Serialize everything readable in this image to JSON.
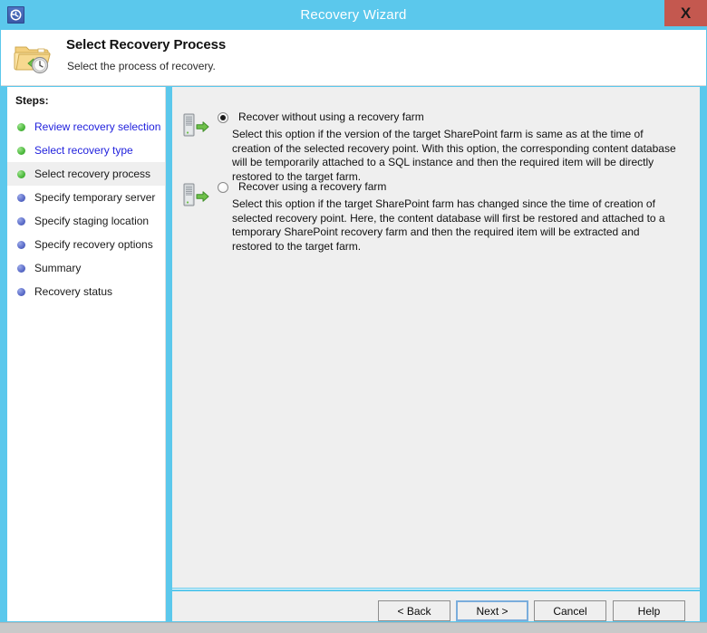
{
  "window": {
    "title": "Recovery Wizard",
    "app_icon": "recovery-clock-icon",
    "close_label": "X",
    "accent_color": "#5bc8ec",
    "close_button_color": "#c4584f"
  },
  "header": {
    "icon": "folder-clock-icon",
    "title": "Select Recovery Process",
    "subtitle": "Select the process of recovery."
  },
  "sidebar": {
    "heading": "Steps:",
    "items": [
      {
        "label": "Review recovery selection",
        "state": "done",
        "is_link": true,
        "current": false
      },
      {
        "label": "Select recovery type",
        "state": "done",
        "is_link": true,
        "current": false
      },
      {
        "label": "Select recovery process",
        "state": "done",
        "is_link": false,
        "current": true
      },
      {
        "label": "Specify temporary server",
        "state": "pending",
        "is_link": false,
        "current": false
      },
      {
        "label": "Specify staging location",
        "state": "pending",
        "is_link": false,
        "current": false
      },
      {
        "label": "Specify recovery options",
        "state": "pending",
        "is_link": false,
        "current": false
      },
      {
        "label": "Summary",
        "state": "pending",
        "is_link": false,
        "current": false
      },
      {
        "label": "Recovery status",
        "state": "pending",
        "is_link": false,
        "current": false
      }
    ]
  },
  "main": {
    "options": [
      {
        "icon": "server-restore-icon",
        "title": "Recover without using a recovery farm",
        "selected": true,
        "description": "Select this option if the version of the target SharePoint farm is same as at the time of creation of the selected recovery point. With this option, the corresponding content database will be temporarily attached to a SQL instance and then the required item will be directly restored to the target farm."
      },
      {
        "icon": "server-restore-icon",
        "title": "Recover using a recovery farm",
        "selected": false,
        "description": "Select this option if the target SharePoint farm has changed since the time of creation of selected recovery point. Here, the content database will first be restored and attached to a temporary SharePoint recovery farm and then the required item will be extracted and restored to the target farm."
      }
    ]
  },
  "buttons": {
    "back": "< Back",
    "next": "Next >",
    "cancel": "Cancel",
    "help": "Help"
  }
}
